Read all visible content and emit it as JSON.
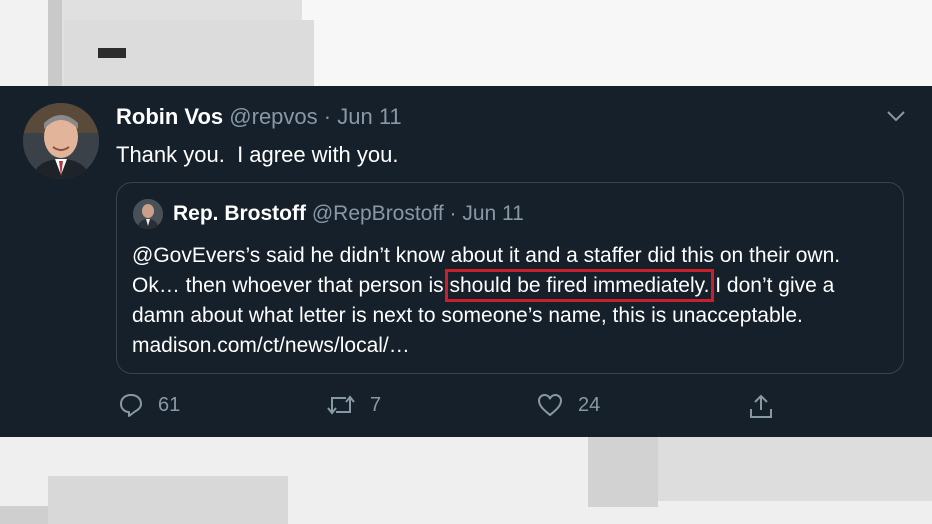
{
  "tweet": {
    "author_name": "Robin Vos",
    "author_handle": "@repvos",
    "separator": "·",
    "date": "Jun 11",
    "text": "Thank you.  I agree with you.",
    "actions": {
      "reply_count": "61",
      "retweet_count": "7",
      "like_count": "24"
    }
  },
  "quoted_tweet": {
    "author_name": "Rep. Brostoff",
    "author_handle": "@RepBrostoff",
    "separator": "·",
    "date": "Jun 11",
    "text_before": "@GovEvers’s said he didn’t know about it and a staffer did this on their own. Ok… then whoever that person is ",
    "text_highlight": "should be fired immediately.",
    "text_after": " I don’t give a damn about what letter is next to someone’s name, this is unacceptable. madison.com/ct/news/local/…"
  },
  "colors": {
    "background": "#15202b",
    "border": "#38444d",
    "secondary_text": "#8899a6",
    "highlight_box": "#cc1f2c"
  },
  "icons": [
    "chevron-down-icon",
    "reply-icon",
    "retweet-icon",
    "heart-icon",
    "share-icon"
  ]
}
